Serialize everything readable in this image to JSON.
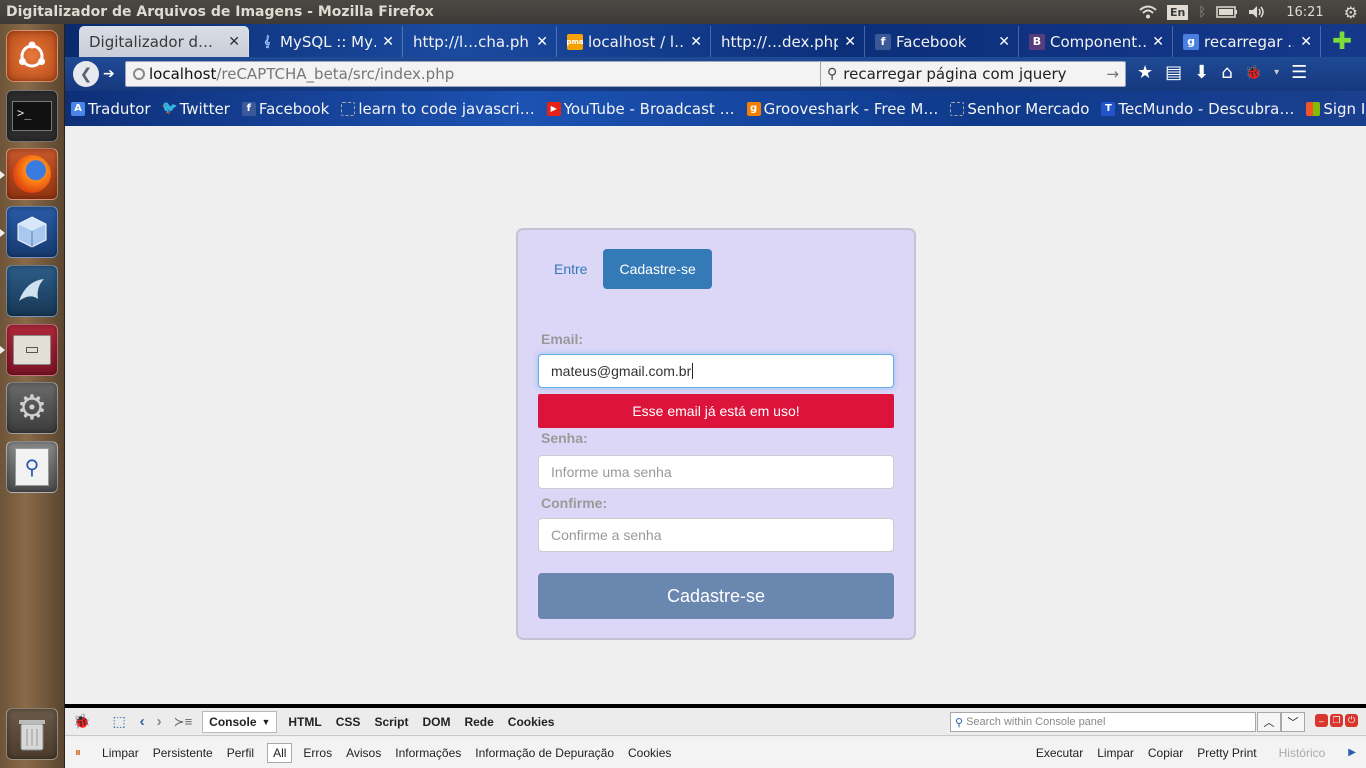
{
  "system": {
    "window_title": "Digitalizador de Arquivos de Imagens - Mozilla Firefox",
    "keyboard_layout": "En",
    "clock": "16:21"
  },
  "launcher": {
    "items": [
      {
        "name": "ubuntu-dash-icon"
      },
      {
        "name": "terminal-icon"
      },
      {
        "name": "firefox-icon"
      },
      {
        "name": "virtualbox-icon"
      },
      {
        "name": "mysql-workbench-icon"
      },
      {
        "name": "file-manager-icon"
      },
      {
        "name": "system-settings-icon"
      },
      {
        "name": "image-viewer-icon"
      },
      {
        "name": "trash-icon"
      }
    ]
  },
  "tabs": [
    {
      "label": "Digitalizador d…",
      "active": true,
      "favicon": ""
    },
    {
      "label": "MySQL :: My…",
      "favicon": "mysql"
    },
    {
      "label": "http://l…cha.php",
      "favicon": ""
    },
    {
      "label": "localhost / l…",
      "favicon": "pma"
    },
    {
      "label": "http://…dex.php",
      "favicon": ""
    },
    {
      "label": "Facebook",
      "favicon": "f"
    },
    {
      "label": "Component…",
      "favicon": "B"
    },
    {
      "label": "recarregar …",
      "favicon": "g"
    }
  ],
  "nav": {
    "url_host": "localhost",
    "url_path": "/reCAPTCHA_beta/src/index.php",
    "search_value": "recarregar página com jquery"
  },
  "bookmarks": [
    {
      "label": "Tradutor",
      "icon": "A"
    },
    {
      "label": "Twitter",
      "icon": "t"
    },
    {
      "label": "Facebook",
      "icon": "f"
    },
    {
      "label": "learn to code javascri…",
      "icon": ""
    },
    {
      "label": "YouTube - Broadcast …",
      "icon": "▶"
    },
    {
      "label": "Grooveshark - Free M…",
      "icon": "g"
    },
    {
      "label": "Senhor Mercado",
      "icon": ""
    },
    {
      "label": "TecMundo - Descubra…",
      "icon": "T"
    },
    {
      "label": "Sign In",
      "icon": ""
    }
  ],
  "form": {
    "tab_login": "Entre",
    "tab_register": "Cadastre-se",
    "email_label": "Email:",
    "email_value": "mateus@gmail.com.br",
    "email_error": "Esse email já está em uso!",
    "password_label": "Senha:",
    "password_placeholder": "Informe uma senha",
    "confirm_label": "Confirme:",
    "confirm_placeholder": "Confirme a senha",
    "submit_label": "Cadastre-se"
  },
  "firebug": {
    "panels": [
      "Console",
      "HTML",
      "CSS",
      "Script",
      "DOM",
      "Rede",
      "Cookies"
    ],
    "search_placeholder": "Search within Console panel",
    "toolbar": [
      "Limpar",
      "Persistente",
      "Perfil"
    ],
    "filters": [
      "All",
      "Erros",
      "Avisos",
      "Informações",
      "Informação de Depuração",
      "Cookies"
    ],
    "actions": [
      "Executar",
      "Limpar",
      "Copiar",
      "Pretty Print"
    ],
    "history": "Histórico"
  },
  "colors": {
    "accent": "#337ab7",
    "error": "#dc143c",
    "card_bg": "#dcd6f7",
    "submit": "#6a87b0"
  }
}
